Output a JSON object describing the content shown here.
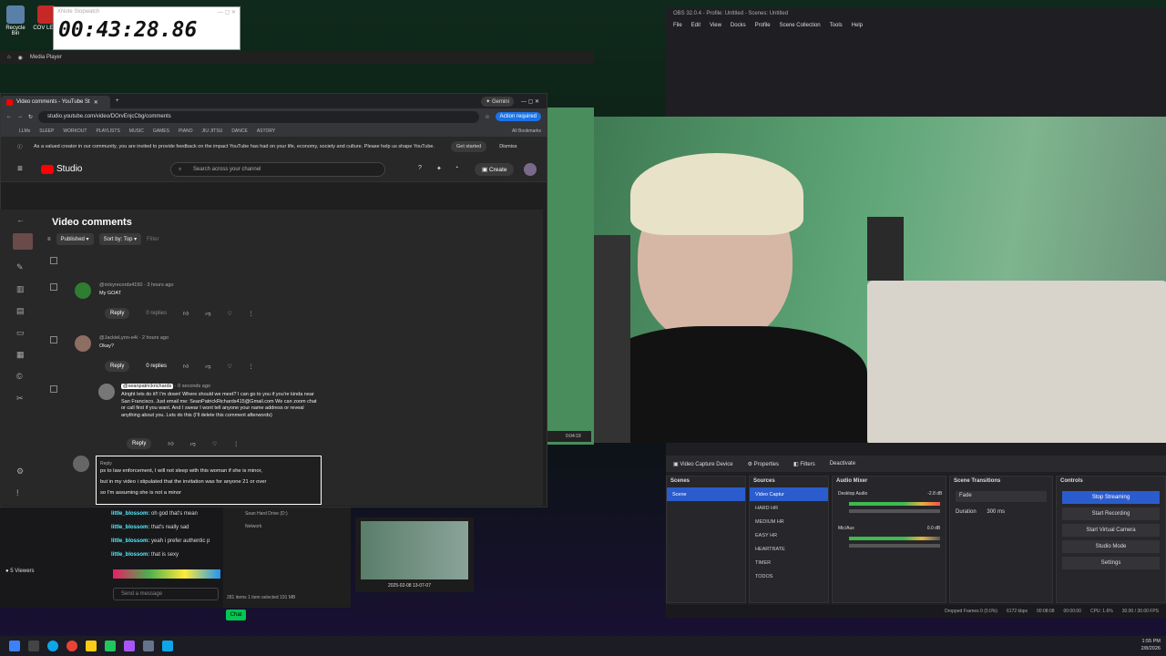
{
  "desktop": {
    "icons": [
      {
        "label": "Recycle Bin"
      },
      {
        "label": "COV LETT"
      }
    ]
  },
  "stopwatch": {
    "title": "XNote Stopwatch",
    "time": "00:43:28.86"
  },
  "media_player": {
    "title": "Media Player"
  },
  "browser": {
    "tab_title": "Video comments - YouTube St",
    "gemini_label": "Gemini",
    "url": "studio.youtube.com/video/DOrvEnjcCbg/comments",
    "action_required": "Action required",
    "bookmarks": [
      "LLMs",
      "SLEEP",
      "WORKOUT",
      "PLAYLISTS",
      "MUSIC",
      "GAMES",
      "PIANO",
      "JIU JITSU",
      "DANCE",
      "ASTORY"
    ],
    "all_bookmarks": "All Bookmarks",
    "banner_text": "As a valued creator in our community, you are invited to provide feedback on the impact YouTube has had on your life, economy, society and culture. Please help us shape YouTube.",
    "banner_get_started": "Get started",
    "banner_dismiss": "Dismiss"
  },
  "studio": {
    "logo_text": "Studio",
    "search_placeholder": "Search across your channel",
    "create_label": "Create",
    "page_title": "Video comments",
    "filter_published": "Published",
    "filter_sort": "Sort by: Top",
    "filter_placeholder": "Filter",
    "comments": [
      {
        "author": "@rickyrecords4150",
        "time": "3 hours ago",
        "text": "My GOAT",
        "reply_label": "Reply",
        "replies": "0 replies"
      },
      {
        "author": "@JackieLynn-e4i",
        "time": "2 hours ago",
        "text": "Okay?",
        "reply_label": "Reply",
        "replies": "0 replies"
      }
    ],
    "reply": {
      "author": "@seanpatrickrichards",
      "time": "0 seconds ago",
      "text_line1": "Alright lets do it!! I'm down! Where should we meet? I can go to you if you're kinda near",
      "text_line2": "San Francisco. Just email me: SeanPatrickRichards415@Gmail.com We can zoom chat",
      "text_line3": "or call first if you want. And I swear I wont tell anyone your name address or reveal",
      "text_line4": "anything about you. Lets do this (I'll delete this comment afterwords)",
      "reply_label": "Reply"
    },
    "draft": {
      "label": "Reply",
      "line1": "ps to law enforcement, I will not sleep with this woman if she is minor,",
      "line2": "but in my video i stipulated that the invitation was for anyone 21 or over",
      "line3": "so I'm assuming she is not a minor"
    }
  },
  "chat": {
    "viewers": "5 Viewers",
    "messages": [
      {
        "user": "little_blossom:",
        "text": "oh god that's mean"
      },
      {
        "user": "little_blossom:",
        "text": "that's really sad"
      },
      {
        "user": "little_blossom:",
        "text": "yeah i prefer authentic p"
      },
      {
        "user": "little_blossom:",
        "text": "that is sexy"
      }
    ],
    "send_placeholder": "Send a message",
    "chat_button": "Chat"
  },
  "explorer": {
    "items": [
      "Sean Hard Drive (D:)",
      "Network"
    ],
    "status": "281 items  1 item selected  191 MB",
    "thumb_caption": "2025-02-08 13-07-07"
  },
  "obs": {
    "title": "OBS 32.0.4 - Profile: Untitled - Scenes: Untitled",
    "menu": [
      "File",
      "Edit",
      "View",
      "Docks",
      "Profile",
      "Scene Collection",
      "Tools",
      "Help"
    ],
    "toolbar": {
      "source": "Video Capture Device",
      "properties": "Properties",
      "filters": "Filters",
      "deactivate": "Deactivate"
    },
    "scenes_title": "Scenes",
    "scenes": [
      "Scene"
    ],
    "sources_title": "Sources",
    "sources": [
      "Video Captur",
      "HARD HR",
      "MEDIUM HR",
      "EASY HR",
      "HEARTRATE",
      "TIMER",
      "TODOS"
    ],
    "mixer_title": "Audio Mixer",
    "mixer": [
      {
        "name": "Desktop Audio",
        "db": "-2.8 dB"
      },
      {
        "name": "Mic/Aux",
        "db": "0.0 dB"
      }
    ],
    "transitions_title": "Scene Transitions",
    "transition": "Fade",
    "duration_label": "Duration",
    "duration": "300 ms",
    "controls_title": "Controls",
    "controls": [
      "Stop Streaming",
      "Start Recording",
      "Start Virtual Camera",
      "Studio Mode",
      "Settings"
    ],
    "status": {
      "dropped": "Dropped Frames 0 (0.0%)",
      "kbps": "6172 kbps",
      "stream_time": "00:08:08",
      "rec_time": "00:00:00",
      "cpu": "CPU: 1.6%",
      "fps": "30.00 / 30.00 FPS"
    },
    "preview_time": "0:04:19",
    "accent": "#2b5ccd"
  },
  "taskbar": {
    "time": "1:55 PM",
    "date": "2/8/2026"
  }
}
